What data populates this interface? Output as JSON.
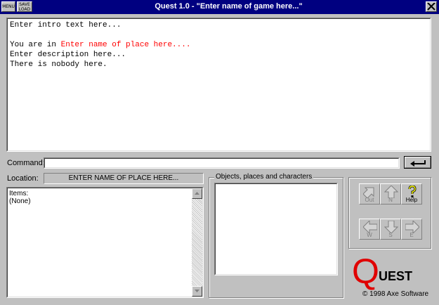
{
  "window": {
    "title": "Quest 1.0 - \"Enter name of game here...\"",
    "menu_label": "MENU",
    "save_label": "SAVE",
    "load_label": "LOAD"
  },
  "output": {
    "intro": "Enter intro text here...",
    "location_prefix": "You are in ",
    "location_name": "Enter name of place here....",
    "description": "Enter description here...",
    "people": "There is nobody here."
  },
  "command": {
    "label": "Command:",
    "value": ""
  },
  "location": {
    "label": "Location:",
    "value": "ENTER NAME OF PLACE HERE..."
  },
  "items": {
    "header": "Items:",
    "value": "(None)"
  },
  "objects": {
    "label": "Objects, places and characters"
  },
  "compass": {
    "out": "Out",
    "north": "N",
    "help": "Help",
    "west": "W",
    "south": "S",
    "east": "E"
  },
  "logo": {
    "q": "Q",
    "rest": "UEST",
    "copyright": "© 1998 Axe Software"
  },
  "colors": {
    "titlebar": "#000080",
    "face": "#c0c0c0",
    "place_highlight": "#ff0000",
    "logo_red": "#e00000"
  }
}
